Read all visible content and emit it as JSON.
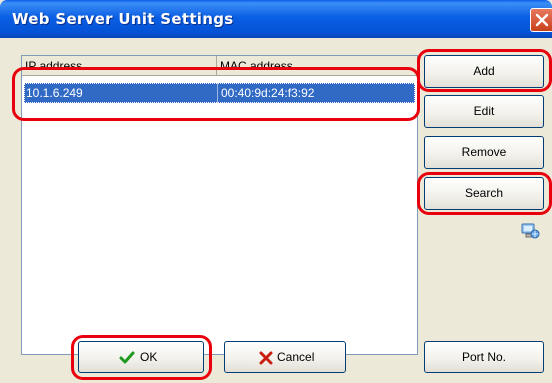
{
  "window": {
    "title": "Web Server Unit Settings"
  },
  "list": {
    "columns": [
      "IP address",
      "MAC address"
    ],
    "rows": [
      {
        "ip": "10.1.6.249",
        "mac": "00:40:9d:24:f3:92",
        "selected": true
      }
    ]
  },
  "buttons": {
    "add": "Add",
    "edit": "Edit",
    "remove": "Remove",
    "search": "Search",
    "ok": "OK",
    "cancel": "Cancel",
    "port": "Port No."
  },
  "icons": {
    "close": "close-icon",
    "network": "network-computer-icon",
    "ok": "checkmark-icon",
    "cancel": "x-mark-icon"
  },
  "colors": {
    "highlight_outline": "#e8000c",
    "selection": "#316ac5",
    "title_bar": "#0a5fe4"
  }
}
